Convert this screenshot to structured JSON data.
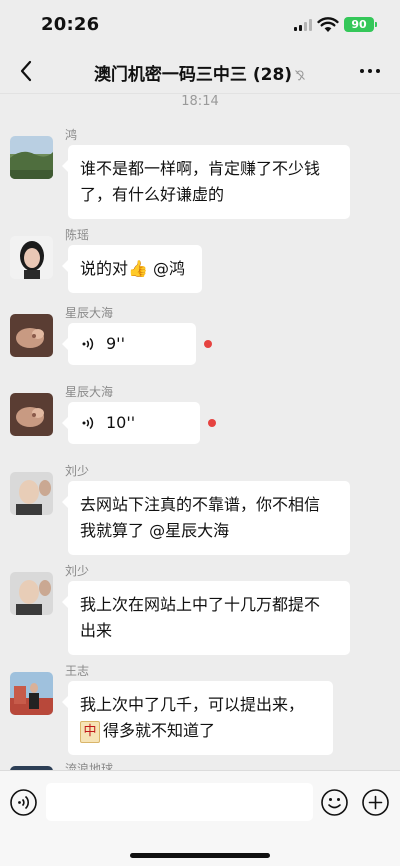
{
  "status_bar": {
    "time": "20:26",
    "battery": "90"
  },
  "header": {
    "title": "澳门机密一码三中三 (28)",
    "mute_icon": "ear-muted-icon",
    "more_icon": "ellipsis-icon",
    "back_icon": "chevron-left-icon"
  },
  "chat": {
    "timestamp": "18:14",
    "messages": [
      {
        "sender": "鸿",
        "type": "text",
        "lines": [
          "谁不是都一样啊，肯定赚了不少钱",
          "了，有什么好谦虚的"
        ]
      },
      {
        "sender": "陈瑶",
        "type": "text",
        "text": "说的对👍 @鸿"
      },
      {
        "sender": "星辰大海",
        "type": "voice",
        "duration": "9''",
        "unread": true
      },
      {
        "sender": "星辰大海",
        "type": "voice",
        "duration": "10''",
        "unread": true
      },
      {
        "sender": "刘少",
        "type": "text",
        "lines": [
          "去网站下注真的不靠谱，你不相信",
          "我就算了 @星辰大海"
        ]
      },
      {
        "sender": "刘少",
        "type": "text",
        "lines": [
          "我上次在网站上中了十几万都提不",
          "出来"
        ]
      },
      {
        "sender": "王志",
        "type": "text",
        "lines": [
          "我上次中了几千，可以提出来，",
          "得多就不知道了"
        ],
        "tag": "中"
      },
      {
        "sender": "流浪地球",
        "type": "text",
        "lines": []
      }
    ]
  },
  "input_bar": {
    "placeholder": "",
    "voice_icon": "voice-input-icon",
    "emoji_icon": "emoji-icon",
    "plus_icon": "plus-icon"
  },
  "colors": {
    "background": "#ededed",
    "bubble": "#ffffff",
    "unread_dot": "#e64340",
    "battery": "#34c759"
  }
}
